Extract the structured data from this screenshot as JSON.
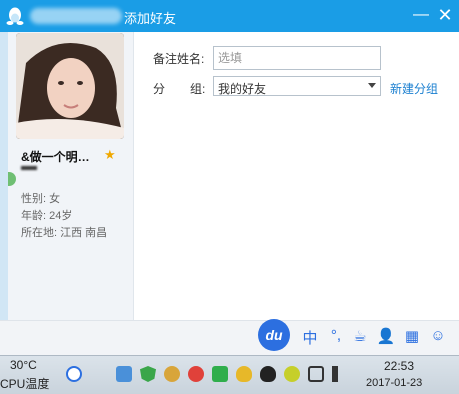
{
  "window": {
    "title": "添加好友",
    "minimize": "—",
    "close": "✕"
  },
  "profile": {
    "nickname": "&做一个明…",
    "gender": "性别: 女",
    "age": "年龄: 24岁",
    "location": "所在地: 江西  南昌"
  },
  "form": {
    "remark_label": "备注姓名:",
    "remark_placeholder": "选填",
    "group_label_1": "分",
    "group_label_2": "组:",
    "group_value": "我的好友",
    "new_group": "新建分组"
  },
  "ime": {
    "logo": "du",
    "items": [
      "中",
      "°,",
      "☕",
      "👤",
      "▦",
      "☺"
    ]
  },
  "taskbar": {
    "temperature": "30°C",
    "cpu_label": "CPU温度",
    "time": "22:53",
    "date": "2017-01-23"
  },
  "colors": {
    "titlebar": "#1a9de6",
    "link": "#1a7fd0",
    "ime_blue": "#2c6fe0"
  }
}
